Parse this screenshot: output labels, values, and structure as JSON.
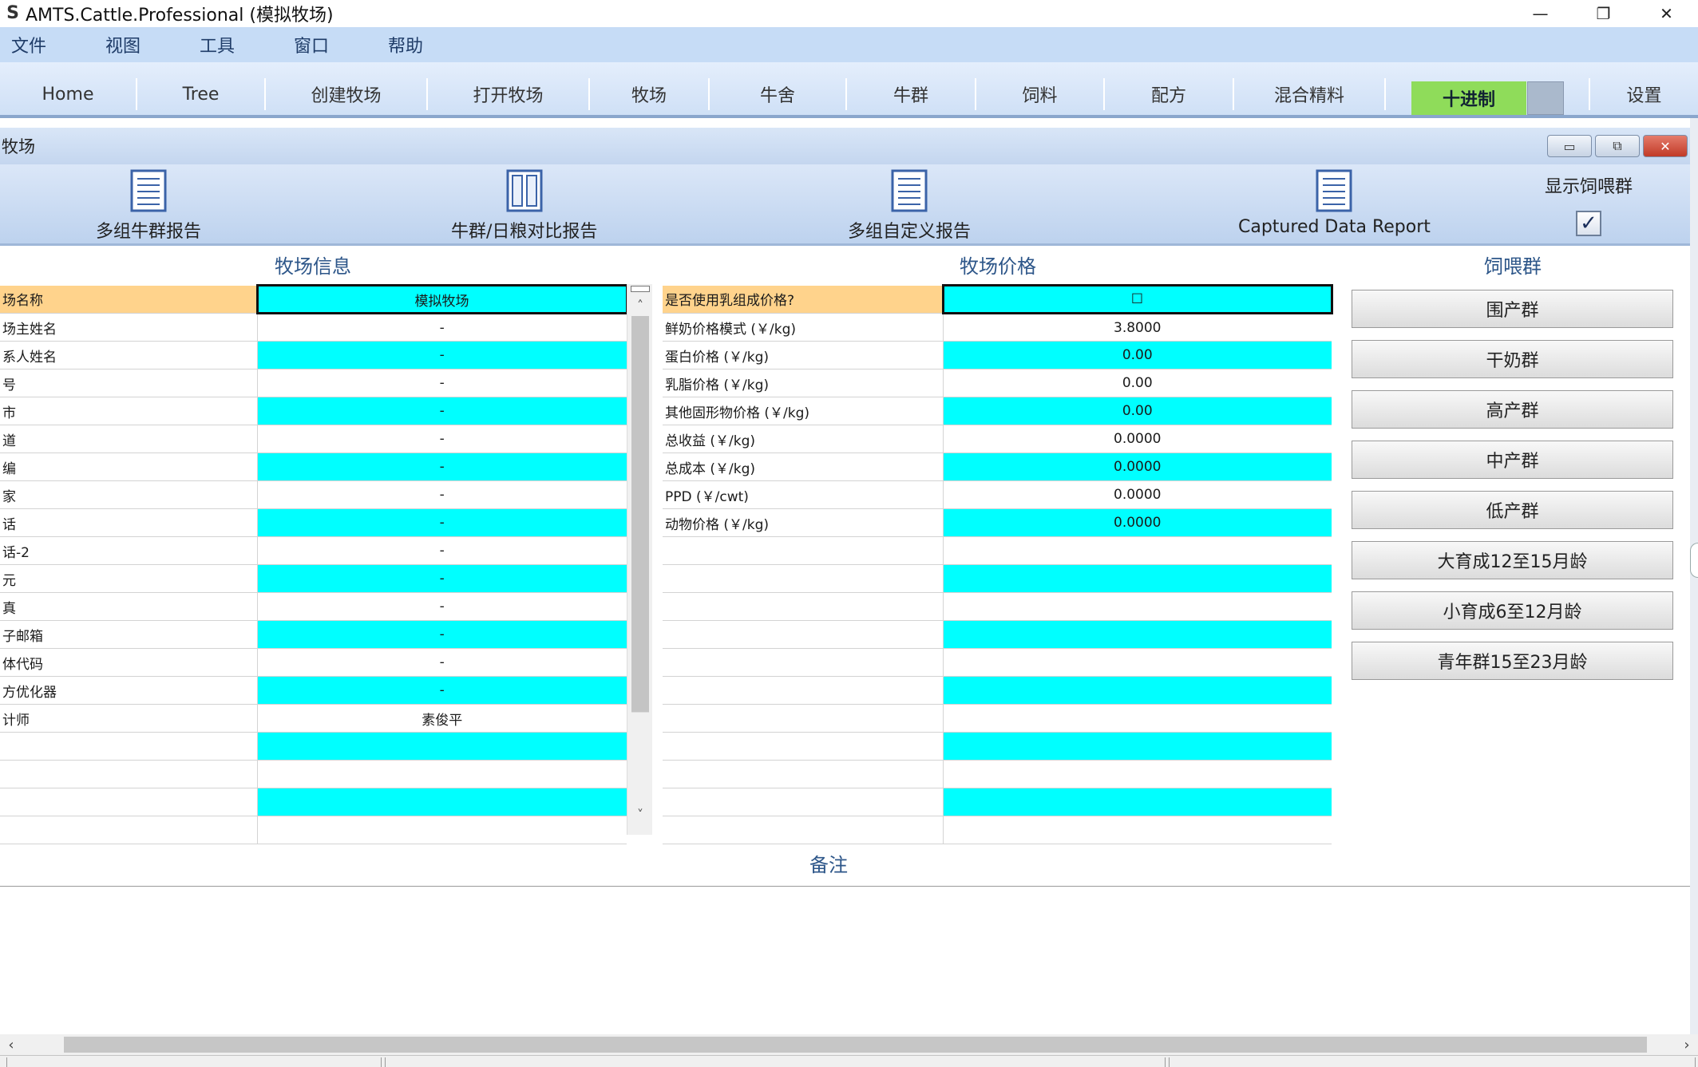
{
  "window": {
    "title": "AMTS.Cattle.Professional (模拟牧场)",
    "app_icon": "S",
    "minimize": "—",
    "restore": "❐",
    "close": "✕"
  },
  "menu": [
    "文件",
    "视图",
    "工具",
    "窗口",
    "帮助"
  ],
  "nav": {
    "items": [
      "Home",
      "Tree",
      "创建牧场",
      "打开牧场",
      "牧场",
      "牛舍",
      "牛群",
      "饲料",
      "配方",
      "混合精料"
    ],
    "decimal": "十进制",
    "settings": "设置"
  },
  "subwindow": {
    "title": "牧场",
    "min": "▭",
    "max": "⧉",
    "close": "✕"
  },
  "reports": {
    "multi_herd": "多组牛群报告",
    "herd_ration": "牛群/日粮对比报告",
    "custom": "多组自定义报告",
    "captured": "Captured Data Report",
    "show_feed_groups": "显示饲喂群",
    "show_feed_checked": "✓"
  },
  "sections": {
    "farm_info": "牧场信息",
    "farm_price": "牧场价格",
    "feed_groups": "饲喂群",
    "notes": "备注"
  },
  "farm_info_rows": [
    {
      "k": "场名称",
      "v": "模拟牧场"
    },
    {
      "k": "场主姓名",
      "v": "-"
    },
    {
      "k": "系人姓名",
      "v": "-"
    },
    {
      "k": "号",
      "v": "-"
    },
    {
      "k": "市",
      "v": "-"
    },
    {
      "k": "道",
      "v": "-"
    },
    {
      "k": "编",
      "v": "-"
    },
    {
      "k": "家",
      "v": "-"
    },
    {
      "k": "话",
      "v": "-"
    },
    {
      "k": "话-2",
      "v": "-"
    },
    {
      "k": "元",
      "v": "-"
    },
    {
      "k": "真",
      "v": "-"
    },
    {
      "k": "子邮箱",
      "v": "-"
    },
    {
      "k": "体代码",
      "v": "-"
    },
    {
      "k": "方优化器",
      "v": "-"
    },
    {
      "k": "计师",
      "v": "素俊平"
    },
    {
      "k": "",
      "v": ""
    },
    {
      "k": "",
      "v": ""
    },
    {
      "k": "",
      "v": ""
    },
    {
      "k": "",
      "v": ""
    }
  ],
  "farm_price_rows": [
    {
      "k": "是否使用乳组成价格?",
      "v": "☐"
    },
    {
      "k": "鲜奶价格模式 (￥/kg)",
      "v": "3.8000"
    },
    {
      "k": "蛋白价格 (￥/kg)",
      "v": "0.00"
    },
    {
      "k": "乳脂价格 (￥/kg)",
      "v": "0.00"
    },
    {
      "k": "其他固形物价格 (￥/kg)",
      "v": "0.00"
    },
    {
      "k": "总收益 (￥/kg)",
      "v": "0.0000"
    },
    {
      "k": "总成本 (￥/kg)",
      "v": "0.0000"
    },
    {
      "k": "PPD (￥/cwt)",
      "v": "0.0000"
    },
    {
      "k": "动物价格 (￥/kg)",
      "v": "0.0000"
    },
    {
      "k": "",
      "v": ""
    },
    {
      "k": "",
      "v": ""
    },
    {
      "k": "",
      "v": ""
    },
    {
      "k": "",
      "v": ""
    },
    {
      "k": "",
      "v": ""
    },
    {
      "k": "",
      "v": ""
    },
    {
      "k": "",
      "v": ""
    },
    {
      "k": "",
      "v": ""
    },
    {
      "k": "",
      "v": ""
    },
    {
      "k": "",
      "v": ""
    },
    {
      "k": "",
      "v": ""
    }
  ],
  "feed_group_buttons": [
    "围产群",
    "干奶群",
    "高产群",
    "中产群",
    "低产群",
    "大育成12至15月龄",
    "小育成6至12月龄",
    "青年群15至23月龄"
  ],
  "scroll": {
    "up": "˄",
    "down": "˅",
    "left": "‹",
    "right": "›"
  },
  "colors": {
    "cyan": "#00ffff",
    "header_orange": "#ffd38c",
    "decimal_green": "#8fdc5a",
    "section_blue": "#2d5689"
  }
}
